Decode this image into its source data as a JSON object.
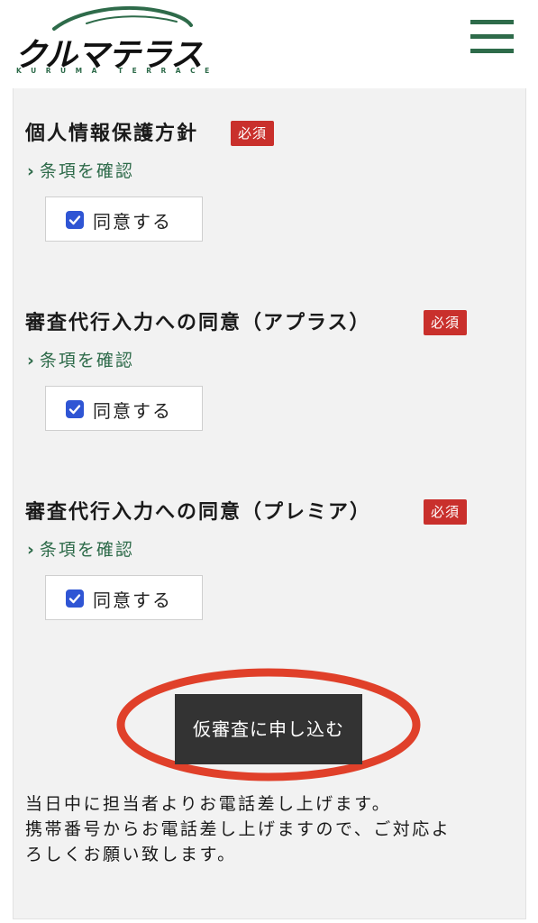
{
  "header": {
    "logo_text": "クルマテラス",
    "logo_subtext": "KURUMA TERRACE",
    "menu_icon": "hamburger-menu-icon",
    "brand_color": "#2e6b4a"
  },
  "sections": [
    {
      "title": "個人情報保護方針",
      "badge": "必須",
      "terms_link": "条項を確認",
      "checkbox_label": "同意する",
      "checked": true
    },
    {
      "title": "審査代行入力への同意（アプラス）",
      "badge": "必須",
      "terms_link": "条項を確認",
      "checkbox_label": "同意する",
      "checked": true
    },
    {
      "title": "審査代行入力への同意（プレミア）",
      "badge": "必須",
      "terms_link": "条項を確認",
      "checkbox_label": "同意する",
      "checked": true
    }
  ],
  "submit": {
    "label": "仮審査に申し込む",
    "highlight_color": "#e0402a"
  },
  "notes": [
    "当日中に担当者よりお電話差し上げます。",
    "携帯番号からお電話差し上げますので、ご対応よ",
    "ろしくお願い致します。"
  ],
  "colors": {
    "required_badge": "#c9302c",
    "checkbox": "#2f55d4",
    "button": "#333333"
  }
}
